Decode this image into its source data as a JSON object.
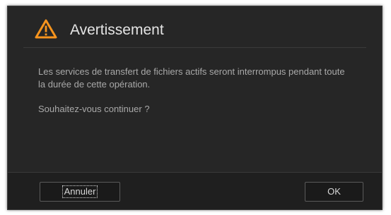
{
  "dialog": {
    "title": "Avertissement",
    "icon": "warning-triangle-icon",
    "message_line1": "Les services de transfert de fichiers actifs seront interrompus pendant toute la durée de cette opération.",
    "message_line2": "Souhaitez-vous continuer ?",
    "buttons": {
      "cancel_label": "Annuler",
      "ok_label": "OK"
    },
    "colors": {
      "accent": "#f7941d",
      "background": "#262626"
    }
  }
}
